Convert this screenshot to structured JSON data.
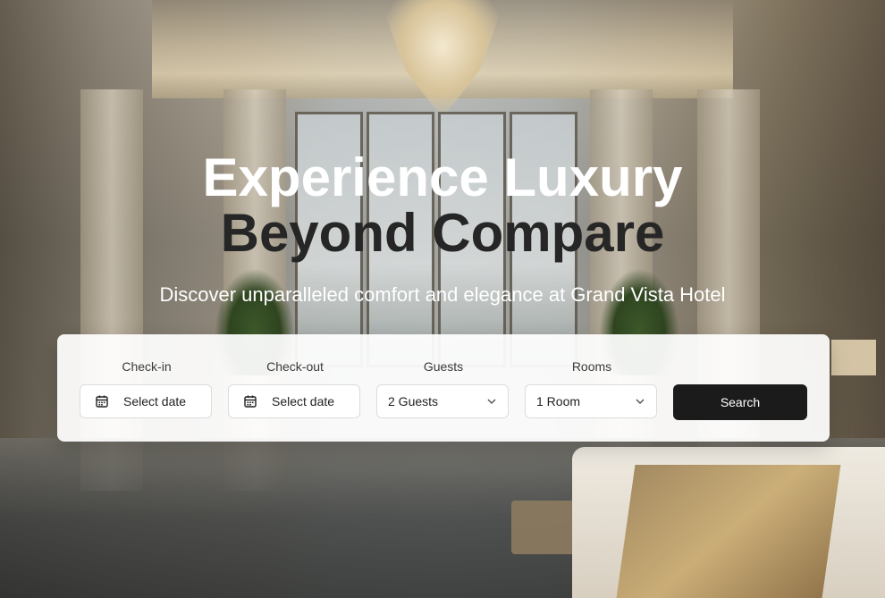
{
  "hero": {
    "headline_line1": "Experience Luxury",
    "headline_line2": "Beyond Compare",
    "subheadline": "Discover unparalleled comfort and elegance at Grand Vista Hotel"
  },
  "booking": {
    "check_in": {
      "label": "Check-in",
      "value": "Select date",
      "icon": "calendar-icon"
    },
    "check_out": {
      "label": "Check-out",
      "value": "Select date",
      "icon": "calendar-icon"
    },
    "guests": {
      "label": "Guests",
      "value": "2 Guests",
      "icon": "chevron-down-icon"
    },
    "rooms": {
      "label": "Rooms",
      "value": "1 Room",
      "icon": "chevron-down-icon"
    },
    "search_label": "Search"
  },
  "colors": {
    "headline_primary": "#ffffff",
    "headline_secondary": "#262626",
    "button_bg": "#1b1b1b",
    "panel_bg": "#ffffff"
  }
}
